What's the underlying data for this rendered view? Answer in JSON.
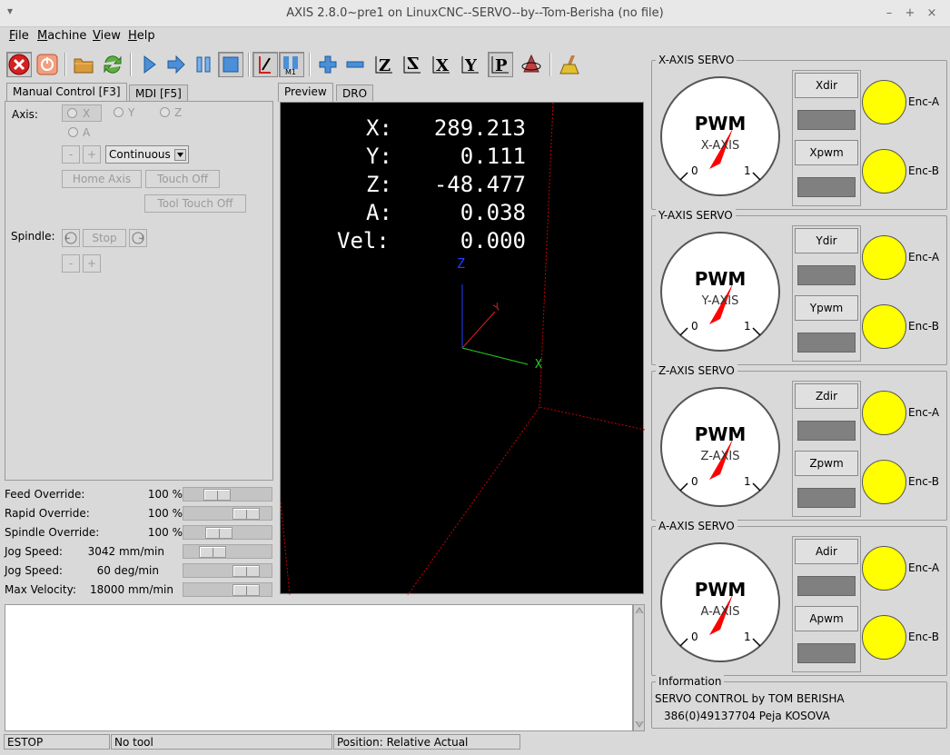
{
  "window": {
    "title": "AXIS 2.8.0~pre1 on LinuxCNC--SERVO--by--Tom-Berisha (no file)",
    "min": "–",
    "max": "+",
    "close": "×",
    "menu_glyph": "▾"
  },
  "menu": [
    {
      "first": "F",
      "rest": "ile"
    },
    {
      "first": "M",
      "rest": "achine"
    },
    {
      "first": "V",
      "rest": "iew"
    },
    {
      "first": "H",
      "rest": "elp"
    }
  ],
  "tabs_left": [
    "Manual Control [F3]",
    "MDI [F5]"
  ],
  "tabs_view": [
    "Preview",
    "DRO"
  ],
  "manual": {
    "axis_label": "Axis:",
    "axes": [
      "X",
      "Y",
      "Z",
      "A"
    ],
    "minus": "-",
    "plus": "+",
    "jog_mode": "Continuous",
    "home_axis": "Home Axis",
    "touch_off": "Touch Off",
    "tool_touch_off": "Tool Touch Off",
    "spindle_label": "Spindle:",
    "stop": "Stop"
  },
  "sliders": [
    {
      "label": "Feed Override:",
      "value": "100 %",
      "pos": 0.33
    },
    {
      "label": "Rapid Override:",
      "value": "100 %",
      "pos": 0.82
    },
    {
      "label": "Spindle Override:",
      "value": "100 %",
      "pos": 0.37
    },
    {
      "label": "Jog Speed:",
      "value": "3042 mm/min",
      "pos": 0.25
    },
    {
      "label": "Jog Speed:",
      "value": "60 deg/min",
      "pos": 0.82
    },
    {
      "label": "Max Velocity:",
      "value": "18000 mm/min",
      "pos": 0.82
    }
  ],
  "dro": [
    {
      "axis": "X:",
      "value": "289.213"
    },
    {
      "axis": "Y:",
      "value": "0.111"
    },
    {
      "axis": "Z:",
      "value": "-48.477"
    },
    {
      "axis": "A:",
      "value": "0.038"
    },
    {
      "axis": "Vel:",
      "value": "0.000"
    }
  ],
  "preview_axis_labels": {
    "z": "Z",
    "y": "Y",
    "x": "X"
  },
  "servos": [
    {
      "title": "X-AXIS SERVO",
      "gauge_title": "PWM",
      "gauge_sub": "X-AXIS",
      "min": "0",
      "max": "1",
      "dir": "Xdir",
      "pwm": "Xpwm",
      "enc_a": "Enc-A",
      "enc_b": "Enc-B"
    },
    {
      "title": "Y-AXIS SERVO",
      "gauge_title": "PWM",
      "gauge_sub": "Y-AXIS",
      "min": "0",
      "max": "1",
      "dir": "Ydir",
      "pwm": "Ypwm",
      "enc_a": "Enc-A",
      "enc_b": "Enc-B"
    },
    {
      "title": "Z-AXIS SERVO",
      "gauge_title": "PWM",
      "gauge_sub": "Z-AXIS",
      "min": "0",
      "max": "1",
      "dir": "Zdir",
      "pwm": "Zpwm",
      "enc_a": "Enc-A",
      "enc_b": "Enc-B"
    },
    {
      "title": "A-AXIS SERVO",
      "gauge_title": "PWM",
      "gauge_sub": "A-AXIS",
      "min": "0",
      "max": "1",
      "dir": "Adir",
      "pwm": "Apwm",
      "enc_a": "Enc-A",
      "enc_b": "Enc-B"
    }
  ],
  "info": {
    "title": "Information",
    "line1": "SERVO CONTROL by  TOM BERISHA",
    "line2": "386(0)49137704  Peja KOSOVA"
  },
  "status": {
    "state": "ESTOP",
    "tool": "No tool",
    "position": "Position: Relative Actual"
  },
  "colors": {
    "led": "#ffff00",
    "needle": "#ff0000",
    "dro_text": "#ffffff",
    "bounds": "#cc0000"
  }
}
